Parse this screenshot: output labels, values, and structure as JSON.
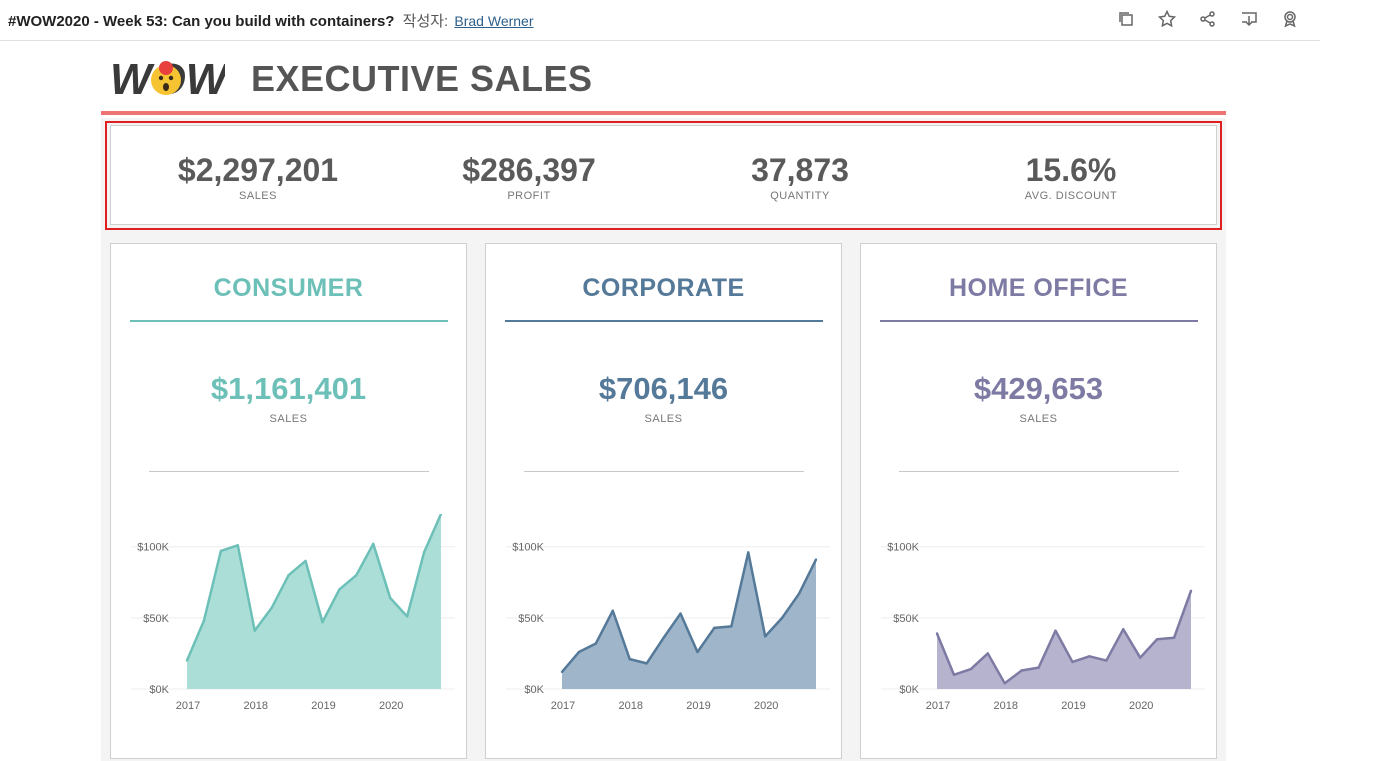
{
  "page": {
    "title": "#WOW2020 - Week 53: Can you build with containers?",
    "by_label": "작성자:",
    "author": "Brad Werner"
  },
  "toolbar": {
    "icons": [
      "copy-icon",
      "star-icon",
      "share-icon",
      "download-icon",
      "badge-icon"
    ]
  },
  "dashboard": {
    "logo_text": "WOW",
    "title": "EXECUTIVE SALES",
    "accent_color": "#f07373",
    "kpis": [
      {
        "value": "$2,297,201",
        "label": "SALES"
      },
      {
        "value": "$286,397",
        "label": "PROFIT"
      },
      {
        "value": "37,873",
        "label": "QUANTITY"
      },
      {
        "value": "15.6%",
        "label": "AVG. DISCOUNT"
      }
    ],
    "segments": [
      {
        "name": "CONSUMER",
        "sales": "$1,161,401",
        "label": "SALES",
        "color": "#6cc0b8",
        "fill": "#a8dcd6"
      },
      {
        "name": "CORPORATE",
        "sales": "$706,146",
        "label": "SALES",
        "color": "#557998",
        "fill": "#9ab1c6"
      },
      {
        "name": "HOME OFFICE",
        "sales": "$429,653",
        "label": "SALES",
        "color": "#7d7ba3",
        "fill": "#b1afcb"
      }
    ]
  },
  "chart_data": [
    {
      "type": "area",
      "series": [
        {
          "name": "CONSUMER",
          "values": [
            20,
            48,
            97,
            101,
            41,
            57,
            80,
            90,
            47,
            70,
            80,
            102,
            64,
            51,
            96,
            123
          ]
        }
      ],
      "x_ticks": [
        "2017",
        "2018",
        "2019",
        "2020"
      ],
      "y_ticks": [
        "$0K",
        "$50K",
        "$100K"
      ],
      "ylim": [
        0,
        123
      ]
    },
    {
      "type": "area",
      "series": [
        {
          "name": "CORPORATE",
          "values": [
            12,
            26,
            32,
            55,
            21,
            18,
            36,
            53,
            26,
            43,
            44,
            96,
            37,
            50,
            67,
            91
          ]
        }
      ],
      "x_ticks": [
        "2017",
        "2018",
        "2019",
        "2020"
      ],
      "y_ticks": [
        "$0K",
        "$50K",
        "$100K"
      ],
      "ylim": [
        0,
        123
      ]
    },
    {
      "type": "area",
      "series": [
        {
          "name": "HOME OFFICE",
          "values": [
            39,
            10,
            14,
            25,
            4,
            13,
            15,
            41,
            19,
            23,
            20,
            42,
            22,
            35,
            36,
            69
          ]
        }
      ],
      "x_ticks": [
        "2017",
        "2018",
        "2019",
        "2020"
      ],
      "y_ticks": [
        "$0K",
        "$50K",
        "$100K"
      ],
      "ylim": [
        0,
        123
      ]
    }
  ]
}
